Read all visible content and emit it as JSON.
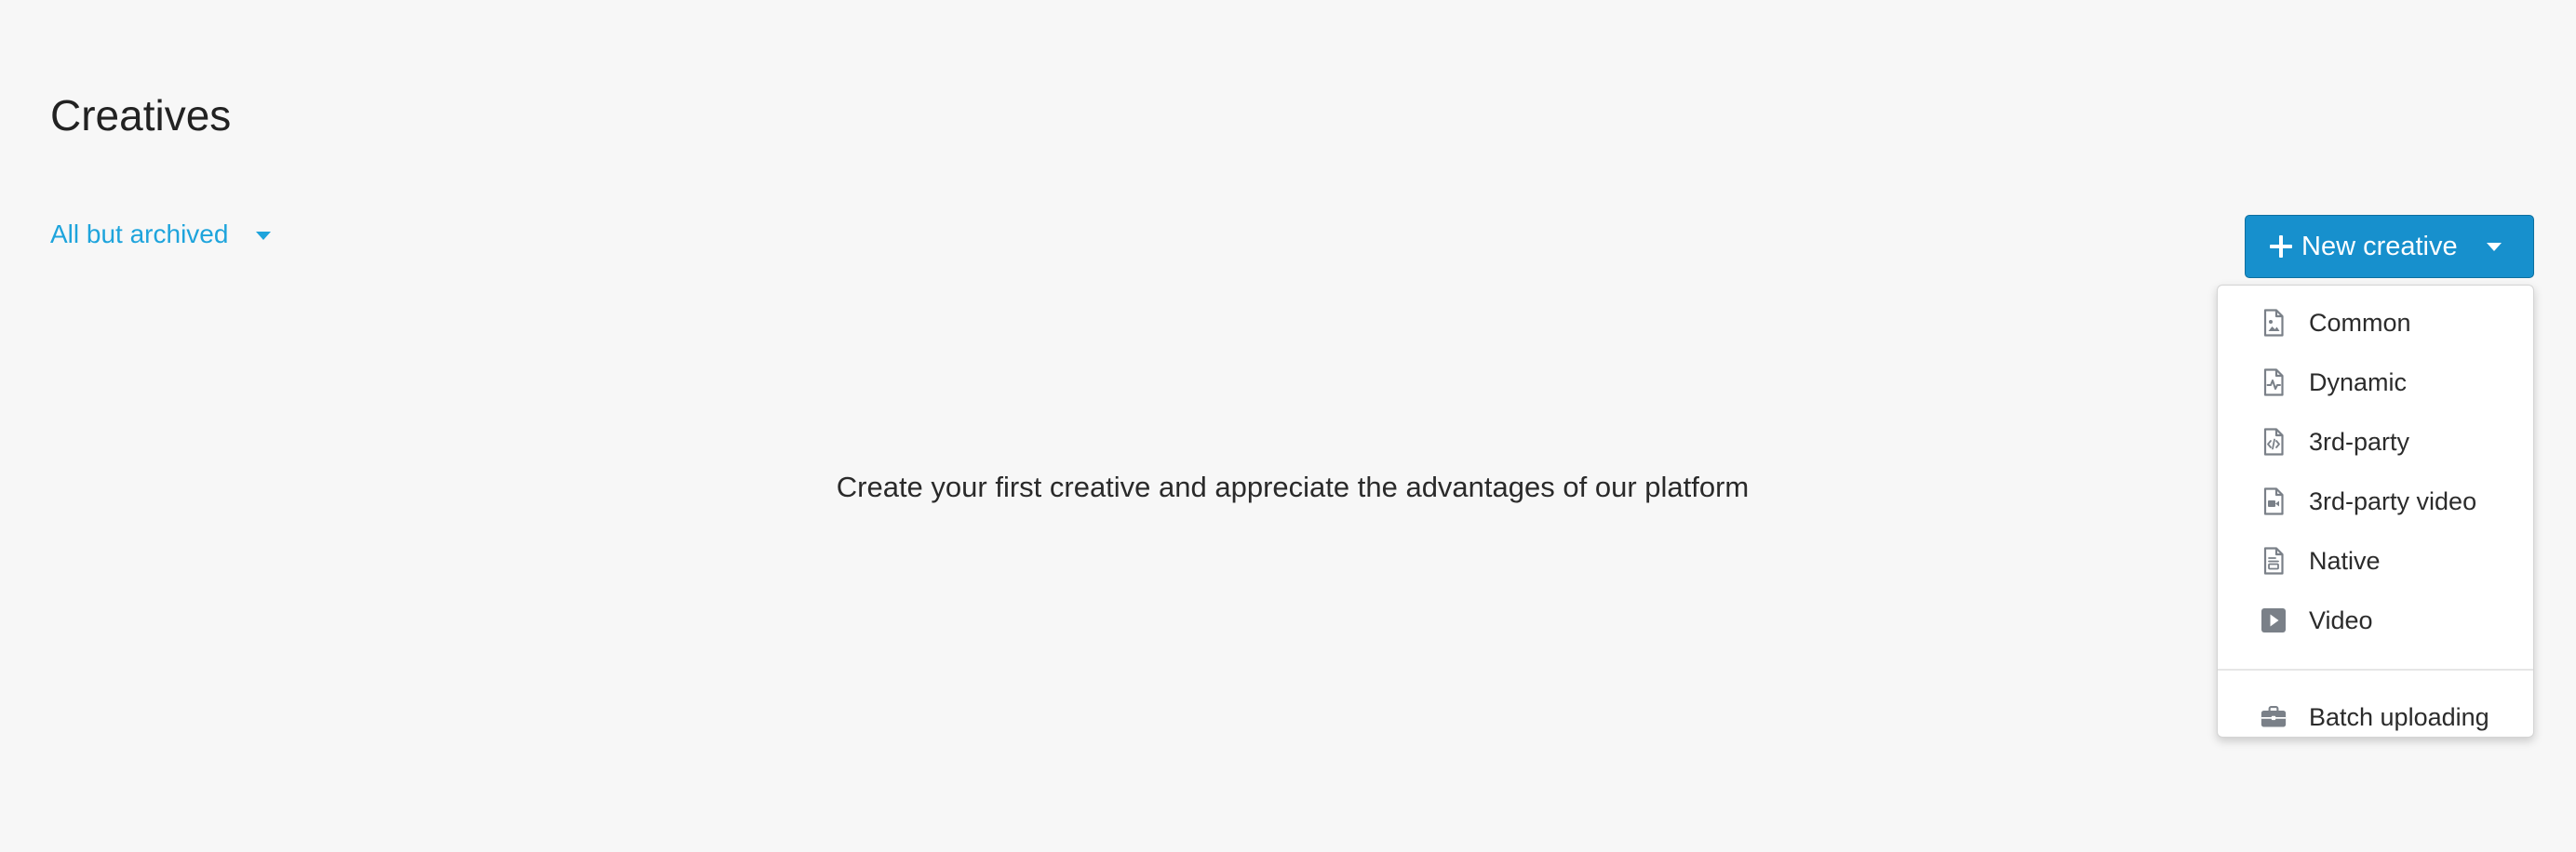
{
  "page": {
    "title": "Creatives"
  },
  "filter": {
    "label": "All but archived"
  },
  "empty_state": {
    "message": "Create your first creative and appreciate the advantages of our platform"
  },
  "new_button": {
    "label": "New creative"
  },
  "menu": {
    "items": [
      {
        "label": "Common",
        "icon": "file-image-icon"
      },
      {
        "label": "Dynamic",
        "icon": "file-pulse-icon"
      },
      {
        "label": "3rd-party",
        "icon": "file-code-icon"
      },
      {
        "label": "3rd-party video",
        "icon": "file-video-icon"
      },
      {
        "label": "Native",
        "icon": "file-native-icon"
      },
      {
        "label": "Video",
        "icon": "play-square-icon"
      }
    ],
    "batch": {
      "label": "Batch uploading",
      "icon": "briefcase-icon"
    }
  },
  "colors": {
    "accent": "#1ea4dc",
    "button": "#1790cd",
    "icon": "#7a8088",
    "background": "#f7f7f7"
  }
}
